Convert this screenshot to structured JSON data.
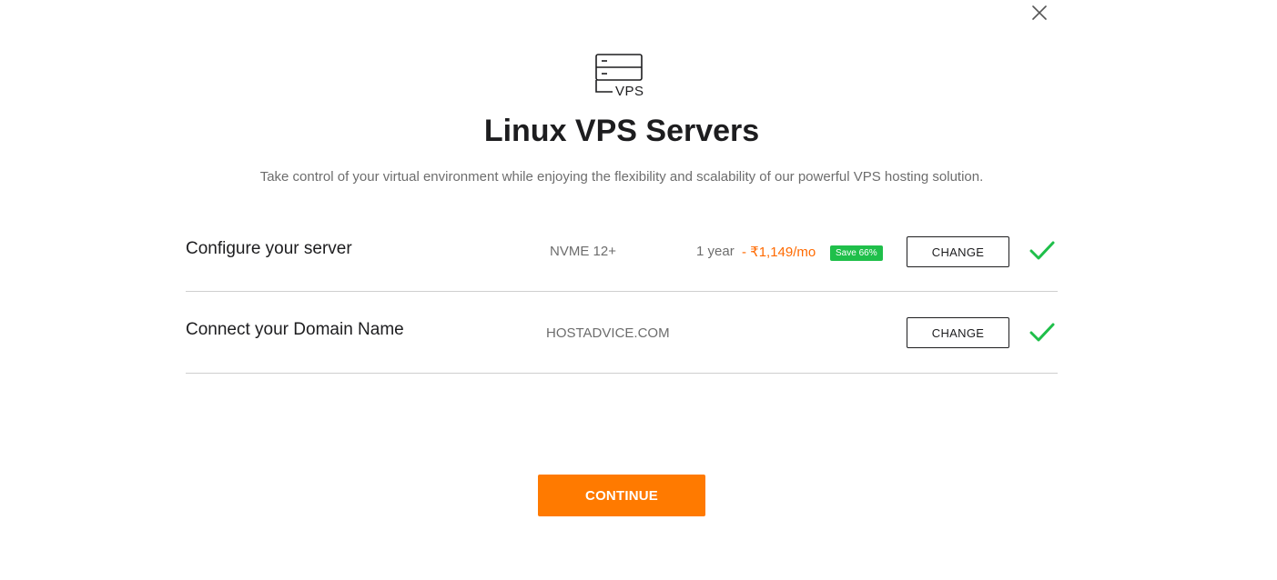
{
  "header": {
    "icon_text": "VPS",
    "title": "Linux VPS Servers",
    "subtitle": "Take control of your virtual environment while enjoying the flexibility and scalability of our powerful VPS hosting solution."
  },
  "rows": [
    {
      "label": "Configure your server",
      "value": "NVME 12+",
      "term": "1 year",
      "price": "- ₹1,149/mo",
      "badge": "Save 66%",
      "change_label": "CHANGE"
    },
    {
      "label": "Connect your Domain Name",
      "value": "HOSTADVICE.COM",
      "change_label": "CHANGE"
    }
  ],
  "footer": {
    "continue_label": "CONTINUE"
  },
  "colors": {
    "accent": "#ff7a00",
    "price": "#ff6a00",
    "badge": "#1fbf4a",
    "check": "#1fbf4a"
  },
  "icons": {
    "close": "close-icon",
    "header": "server-icon",
    "check": "checkmark-icon"
  }
}
